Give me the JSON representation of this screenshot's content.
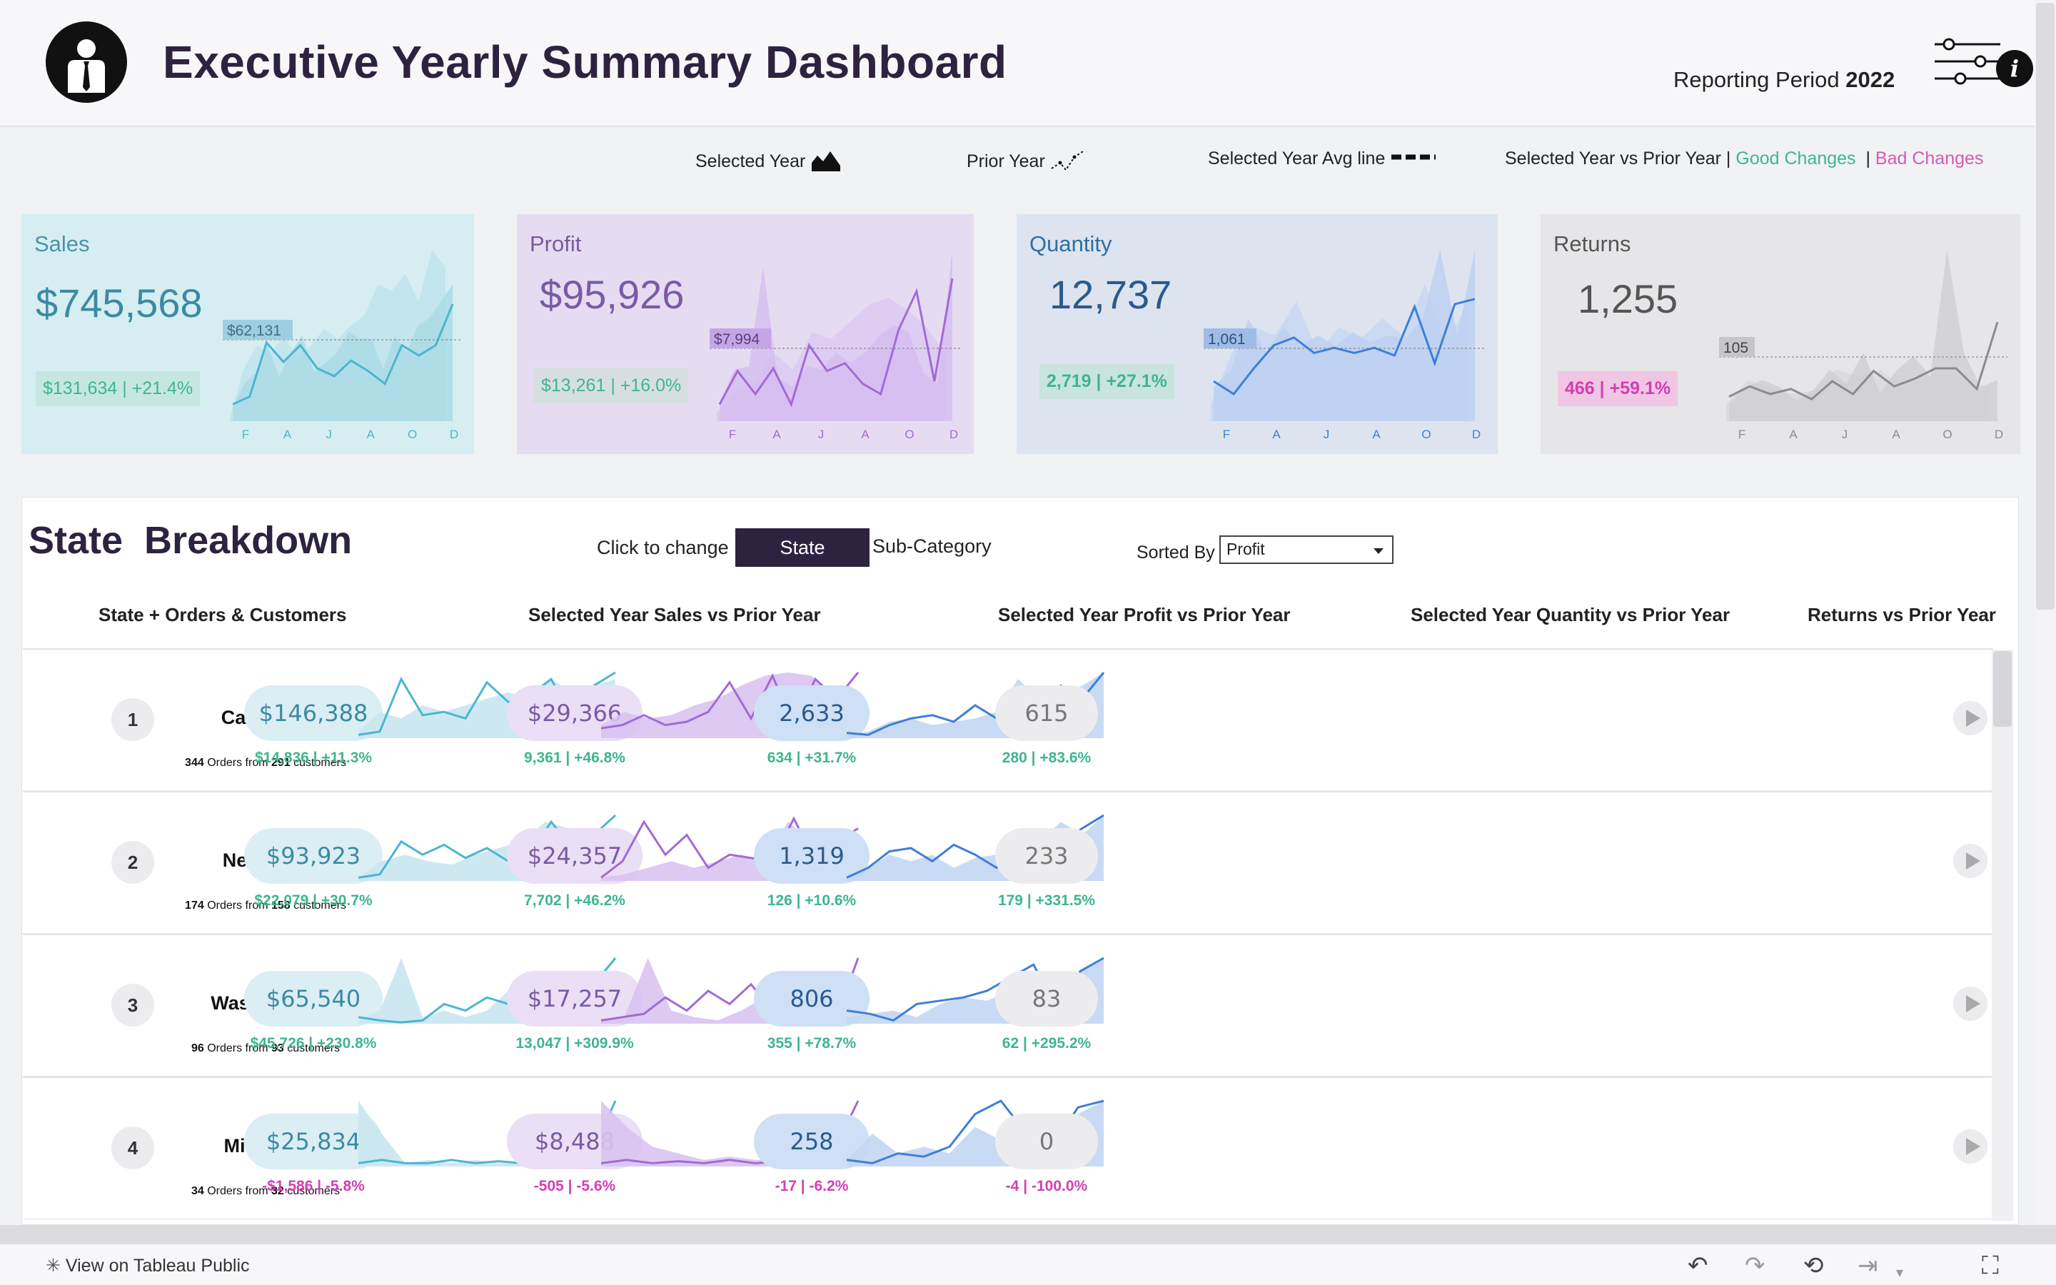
{
  "header": {
    "title": "Executive Yearly Summary Dashboard",
    "reporting_label": "Reporting Period",
    "reporting_year": "2022"
  },
  "legend": {
    "selected_year": "Selected Year",
    "prior_year": "Prior Year",
    "avg_line": "Selected Year Avg line",
    "comparison": "Selected Year vs Prior Year |",
    "good": "Good Changes",
    "separator": "|",
    "bad": "Bad Changes"
  },
  "colors": {
    "sales": "#5bb8cc",
    "profit": "#a36ad6",
    "quantity": "#4b89dc",
    "returns": "#8c8c8c",
    "good": "#3fb591",
    "bad": "#d43fb3",
    "header_dark": "#2d2340"
  },
  "months": [
    "F",
    "A",
    "J",
    "A",
    "O",
    "D"
  ],
  "kpis": [
    {
      "title": "Sales",
      "value": "$745,568",
      "avg_label": "$62,131",
      "change": "$131,634 | +21.4%",
      "avg_level": 0.45,
      "selected": [
        0.08,
        0.22,
        0.28,
        0.45,
        0.26,
        0.4,
        0.5,
        0.29,
        0.34,
        0.4,
        0.52,
        0.48,
        0.48,
        0.3,
        0.5,
        0.4,
        0.56,
        0.6,
        0.7,
        0.8
      ],
      "prior": [
        0.02,
        0.3,
        0.44,
        0.4,
        0.49,
        0.38,
        0.44,
        0.54,
        0.48,
        0.56,
        0.62,
        0.8,
        0.76,
        0.86,
        0.7,
        1.0,
        0.9
      ],
      "line": [
        0.02,
        0.08,
        0.5,
        0.35,
        0.48,
        0.3,
        0.24,
        0.36,
        0.28,
        0.18,
        0.48,
        0.4,
        0.48,
        0.8
      ]
    },
    {
      "title": "Profit",
      "value": "$95,926",
      "avg_label": "$7,994",
      "change": "$13,261 | +16.0%",
      "avg_level": 0.4,
      "selected": [
        0.1,
        0.3,
        0.32,
        0.9,
        0.25,
        0.2,
        0.32,
        0.3,
        0.4,
        0.34,
        0.4,
        0.5,
        0.56,
        0.52,
        0.28,
        0.22,
        1.0
      ],
      "prior": [
        0.05,
        0.18,
        0.22,
        0.4,
        0.3,
        0.52,
        0.48,
        0.58,
        0.68,
        0.72,
        0.65,
        0.55,
        0.4
      ],
      "line": [
        0.02,
        0.28,
        0.1,
        0.3,
        0.02,
        0.48,
        0.28,
        0.34,
        0.18,
        0.1,
        0.6,
        0.9,
        0.2,
        1.0
      ]
    },
    {
      "title": "Quantity",
      "value": "12,737",
      "avg_label": "1,061",
      "change": "2,719 | +27.1%",
      "avg_level": 0.4,
      "selected": [
        0.2,
        0.3,
        0.6,
        0.4,
        0.55,
        0.44,
        0.5,
        0.44,
        0.52,
        0.46,
        0.5,
        0.48,
        0.6,
        1.0,
        0.5,
        1.0
      ],
      "prior": [
        0.1,
        0.4,
        0.55,
        0.5,
        0.7,
        0.4,
        0.55,
        0.48,
        0.6,
        0.5,
        0.8,
        0.44,
        0.7
      ],
      "line": [
        0.2,
        0.1,
        0.3,
        0.48,
        0.54,
        0.42,
        0.46,
        0.42,
        0.46,
        0.4,
        0.78,
        0.34,
        0.8,
        0.84
      ]
    },
    {
      "title": "Returns",
      "value": "1,255",
      "avg_label": "105",
      "change": "466 | +59.1%",
      "avg_level": 0.35,
      "selected": [
        0.1,
        0.2,
        0.24,
        0.2,
        0.12,
        0.18,
        0.3,
        0.22,
        0.4,
        0.16,
        0.3,
        0.38,
        0.26,
        1.0,
        0.4,
        0.2,
        0.24
      ],
      "prior": [
        0.1,
        0.24,
        0.2,
        0.16,
        0.18,
        0.3,
        0.26,
        0.3,
        0.2,
        0.24,
        0.3,
        0.22,
        0.2
      ],
      "line": [
        0.08,
        0.16,
        0.1,
        0.14,
        0.06,
        0.2,
        0.1,
        0.28,
        0.16,
        0.22,
        0.3,
        0.3,
        0.14,
        0.66
      ]
    }
  ],
  "breakdown": {
    "title": "State  Breakdown",
    "click_label": "Click to change",
    "state_button": "State",
    "subcategory_button": "Sub-Category",
    "sorted_by_label": "Sorted By",
    "sorted_by_value": "Profit",
    "columns": [
      "State + Orders & Customers",
      "Selected Year Sales vs  Prior Year",
      "Selected Year Profit vs  Prior Year",
      "Selected Year Quantity vs Prior Year",
      "Returns vs Prior Year"
    ],
    "orders_from": "Orders from",
    "customers": "customers",
    "rows": [
      {
        "rank": "1",
        "state": "California",
        "orders": "344",
        "customers_count": "291",
        "sales": "$146,388",
        "sales_change": "$14,836 | +11.3%",
        "sales_good": true,
        "profit": "$29,366",
        "profit_change": "9,361 | +46.8%",
        "profit_good": true,
        "quantity": "2,633",
        "quantity_change": "634 | +31.7%",
        "quantity_good": true,
        "returns": "615",
        "returns_change": "280 | +83.6%",
        "returns_good": true,
        "s_area": [
          0.1,
          0.4,
          0.3,
          0.5,
          0.4,
          0.5,
          0.6,
          0.7,
          0.6,
          0.9,
          0.7,
          0.8,
          0.9
        ],
        "s_line": [
          0.05,
          0.1,
          0.9,
          0.35,
          0.4,
          0.3,
          0.85,
          0.55,
          0.65,
          0.9,
          0.3,
          0.8,
          1.0
        ],
        "p_area": [
          0.2,
          0.4,
          0.3,
          0.35,
          0.5,
          0.6,
          0.8,
          0.95,
          1.0,
          0.95,
          0.6,
          0.4
        ],
        "p_line": [
          0.15,
          0.2,
          0.35,
          0.2,
          0.25,
          0.4,
          0.85,
          0.3,
          0.95,
          0.2,
          0.9,
          0.6,
          1.0
        ],
        "q_area": [
          0.05,
          0.1,
          0.25,
          0.3,
          0.2,
          0.25,
          0.3,
          0.4,
          0.9,
          0.6,
          0.7,
          0.8,
          1.0
        ],
        "q_line": [
          0.08,
          0.05,
          0.2,
          0.3,
          0.35,
          0.25,
          0.5,
          0.3,
          0.4,
          0.45,
          0.8,
          0.6,
          1.0
        ]
      },
      {
        "rank": "2",
        "state": "New York",
        "orders": "174",
        "customers_count": "158",
        "sales": "$93,923",
        "sales_change": "$22,079 | +30.7%",
        "sales_good": true,
        "profit": "$24,357",
        "profit_change": "7,702 | +46.2%",
        "profit_good": true,
        "quantity": "1,319",
        "quantity_change": "126 | +10.6%",
        "quantity_good": true,
        "returns": "233",
        "returns_change": "179 | +331.5%",
        "returns_good": true,
        "s_area": [
          0.05,
          0.3,
          0.4,
          0.3,
          0.25,
          0.4,
          0.5,
          0.6,
          0.9,
          0.8,
          0.6,
          0.4
        ],
        "s_line": [
          0.05,
          0.1,
          0.6,
          0.4,
          0.55,
          0.35,
          0.5,
          0.3,
          0.4,
          0.9,
          0.5,
          0.7,
          1.0
        ],
        "p_area": [
          0.05,
          0.1,
          0.2,
          0.3,
          0.2,
          0.3,
          0.4,
          0.3,
          0.9,
          0.6,
          0.3,
          0.2
        ],
        "p_line": [
          0.05,
          0.3,
          0.9,
          0.4,
          0.7,
          0.2,
          0.4,
          0.35,
          0.3,
          0.95,
          0.3,
          0.6,
          0.8
        ],
        "q_area": [
          0.05,
          0.2,
          0.4,
          0.3,
          0.4,
          0.2,
          0.35,
          0.4,
          0.8,
          0.6,
          0.9,
          0.7,
          1.0
        ],
        "q_line": [
          0.05,
          0.2,
          0.45,
          0.5,
          0.3,
          0.55,
          0.4,
          0.2,
          0.35,
          0.5,
          0.6,
          0.8,
          1.0
        ]
      },
      {
        "rank": "3",
        "state": "Washington",
        "orders": "96",
        "customers_count": "93",
        "sales": "$65,540",
        "sales_change": "$45,726 | +230.8%",
        "sales_good": true,
        "profit": "$17,257",
        "profit_change": "13,047 | +309.9%",
        "profit_good": true,
        "quantity": "806",
        "quantity_change": "355 | +78.7%",
        "quantity_good": true,
        "returns": "83",
        "returns_change": "62 | +295.2%",
        "returns_good": true,
        "s_area": [
          0.05,
          0.2,
          1.0,
          0.1,
          0.2,
          0.1,
          0.2,
          0.5,
          0.3,
          0.6,
          0.2,
          0.8,
          0.4
        ],
        "s_line": [
          0.1,
          0.05,
          0.02,
          0.05,
          0.3,
          0.2,
          0.4,
          0.3,
          0.35,
          0.2,
          0.15,
          0.6,
          1.0
        ],
        "p_area": [
          0.05,
          0.1,
          1.0,
          0.2,
          0.1,
          0.05,
          0.2,
          0.4,
          0.1,
          0.3,
          0.15,
          0.2
        ],
        "p_line": [
          0.05,
          0.1,
          0.15,
          0.4,
          0.2,
          0.5,
          0.3,
          0.6,
          0.2,
          0.1,
          0.4,
          0.1,
          1.0
        ],
        "q_area": [
          0.1,
          0.15,
          0.2,
          0.1,
          0.3,
          0.4,
          0.35,
          0.5,
          0.7,
          0.6,
          0.8,
          1.0
        ],
        "q_line": [
          0.2,
          0.15,
          0.05,
          0.3,
          0.35,
          0.4,
          0.5,
          0.7,
          0.9,
          0.2,
          0.8,
          1.0
        ]
      },
      {
        "rank": "4",
        "state": "Michigan",
        "orders": "34",
        "customers_count": "32",
        "sales": "$25,834",
        "sales_change": "-$1,586 | -5.8%",
        "sales_good": false,
        "profit": "$8,488",
        "profit_change": "-505 | -5.6%",
        "profit_good": false,
        "quantity": "258",
        "quantity_change": "-17 | -6.2%",
        "quantity_good": false,
        "returns": "0",
        "returns_change": "-4 | -100.0%",
        "returns_good": false,
        "s_area": [
          1.0,
          0.5,
          0.05,
          0.1,
          0.05,
          0.1,
          0.05,
          0.05,
          0.1,
          0.05,
          0.2,
          0.05
        ],
        "s_line": [
          0.05,
          0.1,
          0.05,
          0.05,
          0.1,
          0.05,
          0.08,
          0.05,
          0.1,
          0.05,
          0.2,
          1.0
        ],
        "p_area": [
          1.0,
          0.6,
          0.3,
          0.2,
          0.1,
          0.15,
          0.1,
          0.1,
          0.05,
          0.3,
          0.05
        ],
        "p_line": [
          0.05,
          0.1,
          0.05,
          0.08,
          0.05,
          0.1,
          0.05,
          0.08,
          0.05,
          0.2,
          1.0
        ],
        "q_area": [
          0.1,
          0.5,
          0.2,
          0.3,
          0.2,
          0.6,
          0.4,
          0.2,
          0.5,
          0.8,
          1.0
        ],
        "q_line": [
          0.1,
          0.05,
          0.2,
          0.15,
          0.3,
          0.8,
          1.0,
          0.5,
          0.3,
          0.9,
          1.0
        ]
      }
    ]
  },
  "footer": {
    "view_on_tableau": "View on Tableau Public"
  }
}
